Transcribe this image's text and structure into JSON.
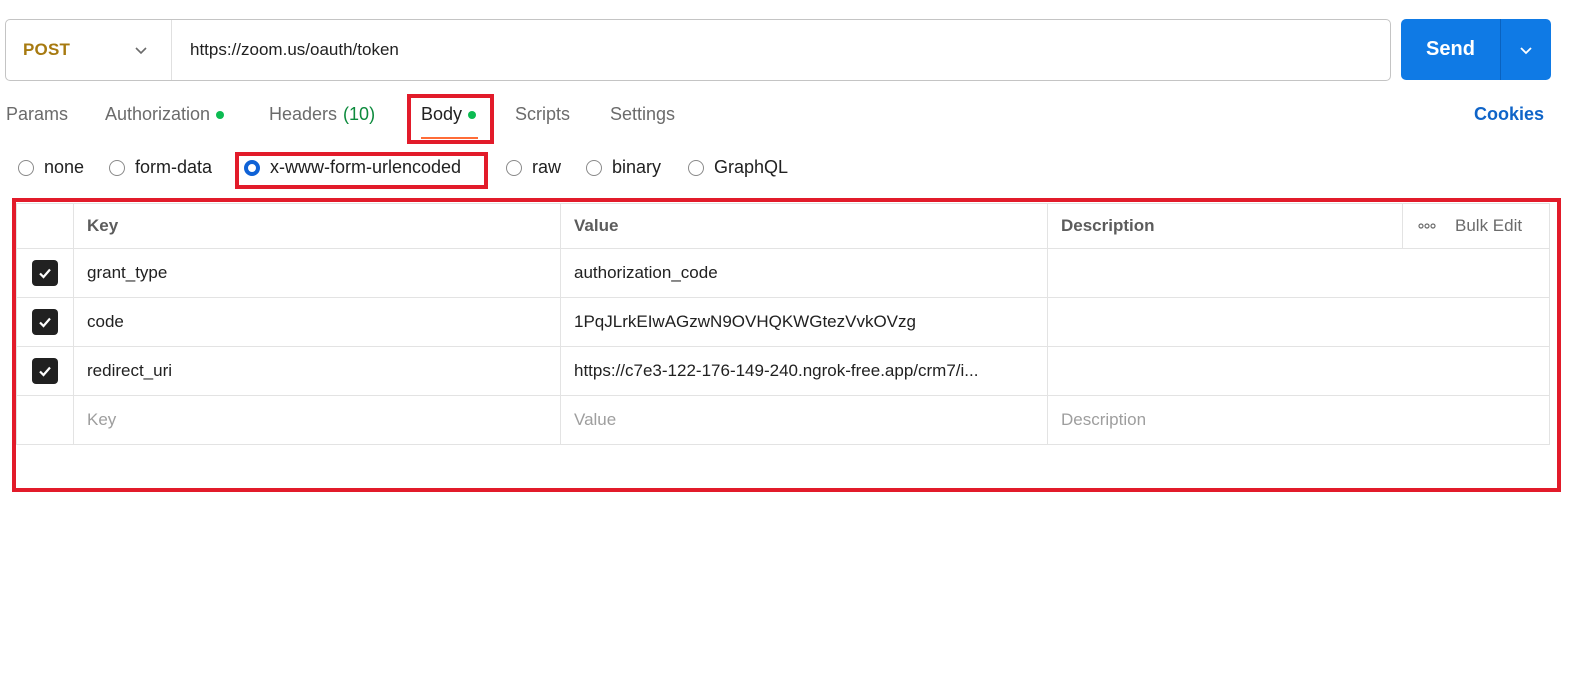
{
  "request": {
    "method": "POST",
    "url": "https://zoom.us/oauth/token",
    "send_label": "Send"
  },
  "tabs": [
    {
      "label": "Params"
    },
    {
      "label": "Authorization"
    },
    {
      "label": "Headers",
      "count": "(10)"
    },
    {
      "label": "Body"
    },
    {
      "label": "Scripts"
    },
    {
      "label": "Settings"
    }
  ],
  "cookies_label": "Cookies",
  "body_types": [
    {
      "label": "none",
      "selected": false
    },
    {
      "label": "form-data",
      "selected": false
    },
    {
      "label": "x-www-form-urlencoded",
      "selected": true
    },
    {
      "label": "raw",
      "selected": false
    },
    {
      "label": "binary",
      "selected": false
    },
    {
      "label": "GraphQL",
      "selected": false
    }
  ],
  "table": {
    "headers": {
      "key": "Key",
      "value": "Value",
      "description": "Description",
      "bulk_edit": "Bulk Edit"
    },
    "rows": [
      {
        "checked": true,
        "key": "grant_type",
        "value": "authorization_code",
        "description": ""
      },
      {
        "checked": true,
        "key": "code",
        "value": "1PqJLrkEIwAGzwN9OVHQKWGtezVvkOVzg",
        "description": ""
      },
      {
        "checked": true,
        "key": "redirect_uri",
        "value": "https://c7e3-122-176-149-240.ngrok-free.app/crm7/i...",
        "description": ""
      }
    ],
    "placeholders": {
      "key": "Key",
      "value": "Value",
      "description": "Description"
    }
  },
  "colors": {
    "method": "#a77a10",
    "send": "#0f7ae5",
    "active_tab_underline": "#ff6c37",
    "status_dot": "#0cbb52",
    "highlight_box": "#e21b2a",
    "cookies_link": "#0f64c8"
  }
}
